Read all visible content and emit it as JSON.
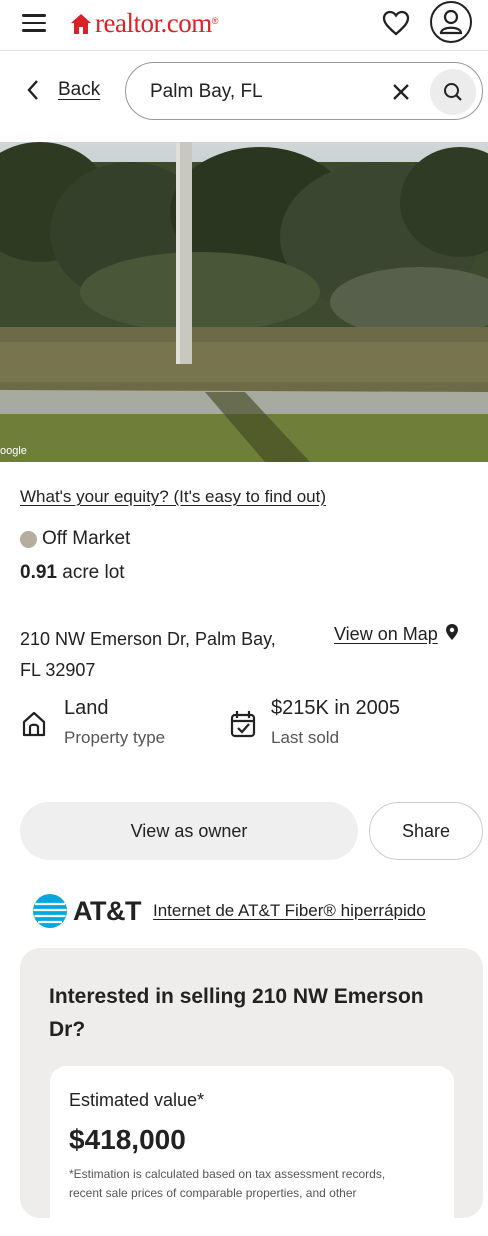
{
  "header": {
    "logo_text": "realtor.com",
    "logo_mark": "®"
  },
  "search": {
    "back_label": "Back",
    "query": "Palm Bay, FL"
  },
  "listing": {
    "photo_credit": "oogle",
    "equity_link": "What's your equity? (It's easy to find out)",
    "status": "Off Market",
    "lot_size_value": "0.91",
    "lot_size_unit": "acre lot",
    "address_line1": "210 NW Emerson Dr, Palm Bay,",
    "address_line2": "FL 32907",
    "view_on_map": "View on Map",
    "facts": [
      {
        "value": "Land",
        "label": "Property type"
      },
      {
        "value": "$215K in 2005",
        "label": "Last sold"
      }
    ]
  },
  "actions": {
    "view_as_owner": "View as owner",
    "share": "Share"
  },
  "ad": {
    "brand": "AT&T",
    "link": "Internet de AT&T Fiber® hiperrápido"
  },
  "sell": {
    "heading_line1": "Interested in selling 210 NW Emerson",
    "heading_line2": "Dr?",
    "estimated_label": "Estimated value*",
    "estimated_value": "$418,000",
    "disclaimer_line1": "*Estimation is calculated based on tax assessment records,",
    "disclaimer_line2": "recent sale prices of comparable properties, and other"
  },
  "colors": {
    "brand_red": "#d92228",
    "att_blue": "#00a8e0",
    "status_gray": "#b6aca0"
  }
}
